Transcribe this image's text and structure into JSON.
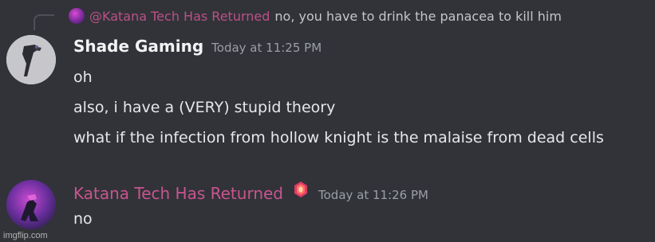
{
  "reply": {
    "mention": "@Katana Tech Has Returned",
    "text": "no, you have to drink the panacea to kill him"
  },
  "messages": [
    {
      "username": "Shade Gaming",
      "timestamp": "Today at 11:25 PM",
      "lines": [
        "oh",
        "also, i have a (VERY) stupid theory",
        "what if the infection from hollow knight is the malaise from dead cells"
      ]
    },
    {
      "username": "Katana Tech Has Returned",
      "timestamp": "Today at 11:26 PM",
      "lines": [
        "no"
      ]
    }
  ],
  "watermark": "imgflip.com",
  "colors": {
    "background": "#313338",
    "katana_name": "#c9548f",
    "shade_name": "#f2f3f5",
    "message_text": "#e6e7ea",
    "timestamp": "#9b9ea6"
  }
}
